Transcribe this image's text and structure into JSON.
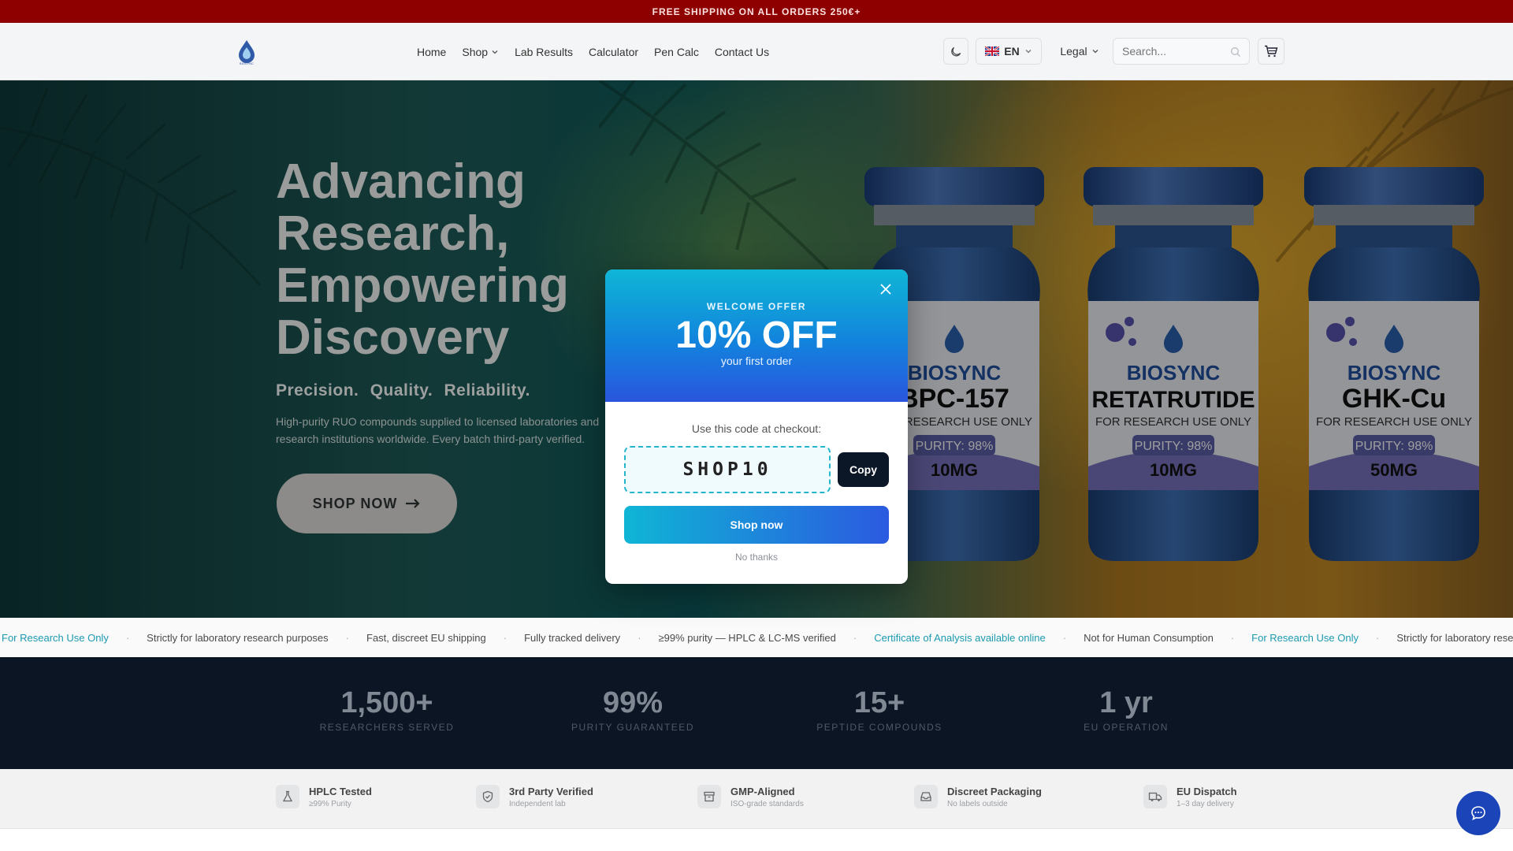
{
  "promo_bar": {
    "text": "FREE SHIPPING ON ALL ORDERS 250€+"
  },
  "header": {
    "logo_text": "BIOSYNC",
    "nav": [
      "Home",
      "Shop",
      "Lab Results",
      "Calculator",
      "Pen Calc",
      "Contact Us"
    ],
    "language": "EN",
    "legal_label": "Legal",
    "search_placeholder": "Search..."
  },
  "hero": {
    "title": "Advancing Research, Empowering Discovery",
    "tagline": "Precision.  Quality.  Reliability.",
    "description": "High-purity RUO compounds supplied to licensed laboratories and research institutions worldwide. Every batch third-party verified.",
    "cta_label": "SHOP NOW",
    "vials": [
      {
        "brand": "BIOSYNC",
        "name": "BPC-157",
        "note": "FOR RESEARCH USE ONLY",
        "purity": "PURITY: 98%",
        "dose": "10MG"
      },
      {
        "brand": "BIOSYNC",
        "name": "RETATRUTIDE",
        "note": "FOR RESEARCH USE ONLY",
        "purity": "PURITY: 98%",
        "dose": "10MG"
      },
      {
        "brand": "BIOSYNC",
        "name": "GHK-Cu",
        "note": "FOR RESEARCH USE ONLY",
        "purity": "PURITY: 98%",
        "dose": "50MG"
      }
    ]
  },
  "ticker": [
    "For Research Use Only",
    "Strictly for laboratory research purposes",
    "Fast, discreet EU shipping",
    "Fully tracked delivery",
    "≥99% purity — HPLC & LC-MS verified",
    "Certificate of Analysis available online",
    "Not for Human Consumption",
    "For Research Use Only",
    "Strictly for laboratory research purposes"
  ],
  "ticker_highlight": [
    true,
    false,
    false,
    false,
    false,
    true,
    false,
    true,
    false
  ],
  "stats": [
    {
      "value": "1,500+",
      "label": "RESEARCHERS SERVED"
    },
    {
      "value": "99%",
      "label": "PURITY GUARANTEED"
    },
    {
      "value": "15+",
      "label": "PEPTIDE COMPOUNDS"
    },
    {
      "value": "1 yr",
      "label": "EU OPERATION"
    }
  ],
  "features": [
    {
      "title": "HPLC Tested",
      "subtitle": "≥99% Purity",
      "icon": "flask-icon"
    },
    {
      "title": "3rd Party Verified",
      "subtitle": "Independent lab",
      "icon": "shield-check-icon"
    },
    {
      "title": "GMP-Aligned",
      "subtitle": "ISO-grade standards",
      "icon": "archive-box-icon"
    },
    {
      "title": "Discreet Packaging",
      "subtitle": "No labels outside",
      "icon": "inbox-icon"
    },
    {
      "title": "EU Dispatch",
      "subtitle": "1–3 day delivery",
      "icon": "truck-icon"
    }
  ],
  "modal": {
    "eyebrow": "WELCOME OFFER",
    "headline": "10% OFF",
    "subheadline": "your first order",
    "hint": "Use this code at checkout:",
    "code": "SHOP10",
    "copy_label": "Copy",
    "cta_label": "Shop now",
    "dismiss_label": "No thanks"
  },
  "colors": {
    "promo_bg": "#8e0000",
    "stats_bg": "#0b1524",
    "modal_gradient_start": "#0fb6d6",
    "modal_gradient_end": "#2a55de",
    "ticker_accent": "#1c9ab0",
    "chat_button": "#1a44b8"
  }
}
